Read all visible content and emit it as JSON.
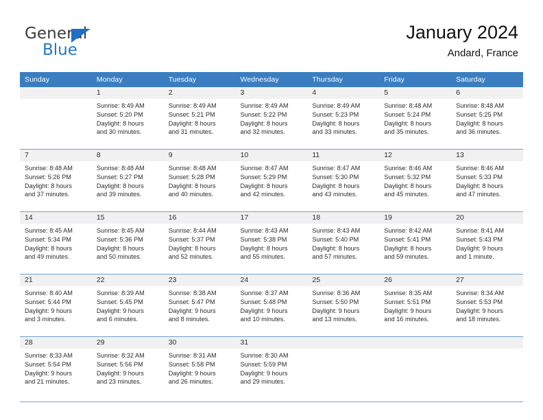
{
  "brand": {
    "name_top": "General",
    "name_bottom": "Blue",
    "triangle_icon": "blue-triangle-icon",
    "color_dark": "#3b3b3b",
    "color_blue": "#1f79c9"
  },
  "header": {
    "title": "January 2024",
    "subtitle": "Andard, France"
  },
  "theme": {
    "header_bar": "#3a7dc0",
    "row_divider": "#6e9fd0",
    "daynum_band": "#f1f1f1",
    "text": "#2b2b2b"
  },
  "calendar": {
    "weekday_headers": [
      "Sunday",
      "Monday",
      "Tuesday",
      "Wednesday",
      "Thursday",
      "Friday",
      "Saturday"
    ],
    "weeks": [
      [
        {
          "day": "",
          "lines": []
        },
        {
          "day": "1",
          "lines": [
            "Sunrise: 8:49 AM",
            "Sunset: 5:20 PM",
            "Daylight: 8 hours",
            "and 30 minutes."
          ]
        },
        {
          "day": "2",
          "lines": [
            "Sunrise: 8:49 AM",
            "Sunset: 5:21 PM",
            "Daylight: 8 hours",
            "and 31 minutes."
          ]
        },
        {
          "day": "3",
          "lines": [
            "Sunrise: 8:49 AM",
            "Sunset: 5:22 PM",
            "Daylight: 8 hours",
            "and 32 minutes."
          ]
        },
        {
          "day": "4",
          "lines": [
            "Sunrise: 8:49 AM",
            "Sunset: 5:23 PM",
            "Daylight: 8 hours",
            "and 33 minutes."
          ]
        },
        {
          "day": "5",
          "lines": [
            "Sunrise: 8:48 AM",
            "Sunset: 5:24 PM",
            "Daylight: 8 hours",
            "and 35 minutes."
          ]
        },
        {
          "day": "6",
          "lines": [
            "Sunrise: 8:48 AM",
            "Sunset: 5:25 PM",
            "Daylight: 8 hours",
            "and 36 minutes."
          ]
        }
      ],
      [
        {
          "day": "7",
          "lines": [
            "Sunrise: 8:48 AM",
            "Sunset: 5:26 PM",
            "Daylight: 8 hours",
            "and 37 minutes."
          ]
        },
        {
          "day": "8",
          "lines": [
            "Sunrise: 8:48 AM",
            "Sunset: 5:27 PM",
            "Daylight: 8 hours",
            "and 39 minutes."
          ]
        },
        {
          "day": "9",
          "lines": [
            "Sunrise: 8:48 AM",
            "Sunset: 5:28 PM",
            "Daylight: 8 hours",
            "and 40 minutes."
          ]
        },
        {
          "day": "10",
          "lines": [
            "Sunrise: 8:47 AM",
            "Sunset: 5:29 PM",
            "Daylight: 8 hours",
            "and 42 minutes."
          ]
        },
        {
          "day": "11",
          "lines": [
            "Sunrise: 8:47 AM",
            "Sunset: 5:30 PM",
            "Daylight: 8 hours",
            "and 43 minutes."
          ]
        },
        {
          "day": "12",
          "lines": [
            "Sunrise: 8:46 AM",
            "Sunset: 5:32 PM",
            "Daylight: 8 hours",
            "and 45 minutes."
          ]
        },
        {
          "day": "13",
          "lines": [
            "Sunrise: 8:46 AM",
            "Sunset: 5:33 PM",
            "Daylight: 8 hours",
            "and 47 minutes."
          ]
        }
      ],
      [
        {
          "day": "14",
          "lines": [
            "Sunrise: 8:45 AM",
            "Sunset: 5:34 PM",
            "Daylight: 8 hours",
            "and 49 minutes."
          ]
        },
        {
          "day": "15",
          "lines": [
            "Sunrise: 8:45 AM",
            "Sunset: 5:36 PM",
            "Daylight: 8 hours",
            "and 50 minutes."
          ]
        },
        {
          "day": "16",
          "lines": [
            "Sunrise: 8:44 AM",
            "Sunset: 5:37 PM",
            "Daylight: 8 hours",
            "and 52 minutes."
          ]
        },
        {
          "day": "17",
          "lines": [
            "Sunrise: 8:43 AM",
            "Sunset: 5:38 PM",
            "Daylight: 8 hours",
            "and 55 minutes."
          ]
        },
        {
          "day": "18",
          "lines": [
            "Sunrise: 8:43 AM",
            "Sunset: 5:40 PM",
            "Daylight: 8 hours",
            "and 57 minutes."
          ]
        },
        {
          "day": "19",
          "lines": [
            "Sunrise: 8:42 AM",
            "Sunset: 5:41 PM",
            "Daylight: 8 hours",
            "and 59 minutes."
          ]
        },
        {
          "day": "20",
          "lines": [
            "Sunrise: 8:41 AM",
            "Sunset: 5:43 PM",
            "Daylight: 9 hours",
            "and 1 minute."
          ]
        }
      ],
      [
        {
          "day": "21",
          "lines": [
            "Sunrise: 8:40 AM",
            "Sunset: 5:44 PM",
            "Daylight: 9 hours",
            "and 3 minutes."
          ]
        },
        {
          "day": "22",
          "lines": [
            "Sunrise: 8:39 AM",
            "Sunset: 5:45 PM",
            "Daylight: 9 hours",
            "and 6 minutes."
          ]
        },
        {
          "day": "23",
          "lines": [
            "Sunrise: 8:38 AM",
            "Sunset: 5:47 PM",
            "Daylight: 9 hours",
            "and 8 minutes."
          ]
        },
        {
          "day": "24",
          "lines": [
            "Sunrise: 8:37 AM",
            "Sunset: 5:48 PM",
            "Daylight: 9 hours",
            "and 10 minutes."
          ]
        },
        {
          "day": "25",
          "lines": [
            "Sunrise: 8:36 AM",
            "Sunset: 5:50 PM",
            "Daylight: 9 hours",
            "and 13 minutes."
          ]
        },
        {
          "day": "26",
          "lines": [
            "Sunrise: 8:35 AM",
            "Sunset: 5:51 PM",
            "Daylight: 9 hours",
            "and 16 minutes."
          ]
        },
        {
          "day": "27",
          "lines": [
            "Sunrise: 8:34 AM",
            "Sunset: 5:53 PM",
            "Daylight: 9 hours",
            "and 18 minutes."
          ]
        }
      ],
      [
        {
          "day": "28",
          "lines": [
            "Sunrise: 8:33 AM",
            "Sunset: 5:54 PM",
            "Daylight: 9 hours",
            "and 21 minutes."
          ]
        },
        {
          "day": "29",
          "lines": [
            "Sunrise: 8:32 AM",
            "Sunset: 5:56 PM",
            "Daylight: 9 hours",
            "and 23 minutes."
          ]
        },
        {
          "day": "30",
          "lines": [
            "Sunrise: 8:31 AM",
            "Sunset: 5:58 PM",
            "Daylight: 9 hours",
            "and 26 minutes."
          ]
        },
        {
          "day": "31",
          "lines": [
            "Sunrise: 8:30 AM",
            "Sunset: 5:59 PM",
            "Daylight: 9 hours",
            "and 29 minutes."
          ]
        },
        {
          "day": "",
          "lines": []
        },
        {
          "day": "",
          "lines": []
        },
        {
          "day": "",
          "lines": []
        }
      ]
    ]
  }
}
